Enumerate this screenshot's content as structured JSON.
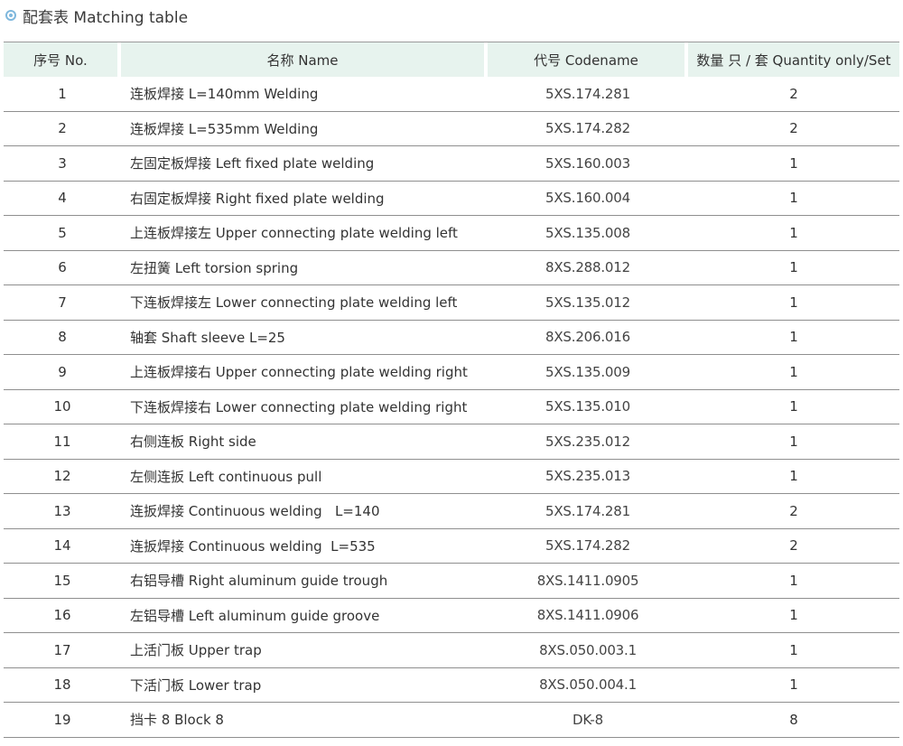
{
  "title": "配套表 Matching table",
  "headers": {
    "no": "序号 No.",
    "name": "名称 Name",
    "code": "代号 Codename",
    "qty": "数量 只 / 套 Quantity only/Set"
  },
  "rows": [
    {
      "no": "1",
      "name": "连板焊接 L=140mm Welding",
      "code": "5XS.174.281",
      "qty": "2"
    },
    {
      "no": "2",
      "name": "连板焊接 L=535mm Welding",
      "code": "5XS.174.282",
      "qty": "2"
    },
    {
      "no": "3",
      "name": "左固定板焊接 Left fixed plate welding",
      "code": "5XS.160.003",
      "qty": "1"
    },
    {
      "no": "4",
      "name": "右固定板焊接 Right fixed plate welding",
      "code": "5XS.160.004",
      "qty": "1"
    },
    {
      "no": "5",
      "name": "上连板焊接左 Upper connecting plate welding left",
      "code": "5XS.135.008",
      "qty": "1"
    },
    {
      "no": "6",
      "name": "左扭簧 Left torsion spring",
      "code": "8XS.288.012",
      "qty": "1"
    },
    {
      "no": "7",
      "name": "下连板焊接左 Lower connecting plate welding left",
      "code": "5XS.135.012",
      "qty": "1"
    },
    {
      "no": "8",
      "name": "轴套 Shaft sleeve L=25",
      "code": "8XS.206.016",
      "qty": "1"
    },
    {
      "no": "9",
      "name": "上连板焊接右 Upper connecting plate welding right",
      "code": "5XS.135.009",
      "qty": "1"
    },
    {
      "no": "10",
      "name": "下连板焊接右 Lower connecting plate welding right",
      "code": "5XS.135.010",
      "qty": "1"
    },
    {
      "no": "11",
      "name": "右侧连板 Right side",
      "code": "5XS.235.012",
      "qty": "1"
    },
    {
      "no": "12",
      "name": "左侧连扳 Left continuous pull",
      "code": "5XS.235.013",
      "qty": "1"
    },
    {
      "no": "13",
      "name": "连扳焊接 Continuous welding   L=140",
      "code": "5XS.174.281",
      "qty": "2"
    },
    {
      "no": "14",
      "name": "连扳焊接 Continuous welding  L=535",
      "code": "5XS.174.282",
      "qty": "2"
    },
    {
      "no": "15",
      "name": "右铝导槽 Right aluminum guide trough",
      "code": "8XS.1411.0905",
      "qty": "1"
    },
    {
      "no": "16",
      "name": "左铝导槽 Left aluminum guide groove",
      "code": "8XS.1411.0906",
      "qty": "1"
    },
    {
      "no": "17",
      "name": "上活门板 Upper trap",
      "code": "8XS.050.003.1",
      "qty": "1"
    },
    {
      "no": "18",
      "name": "下活门板 Lower trap",
      "code": "8XS.050.004.1",
      "qty": "1"
    },
    {
      "no": "19",
      "name": "挡卡 8 Block 8",
      "code": "DK-8",
      "qty": "8"
    }
  ]
}
